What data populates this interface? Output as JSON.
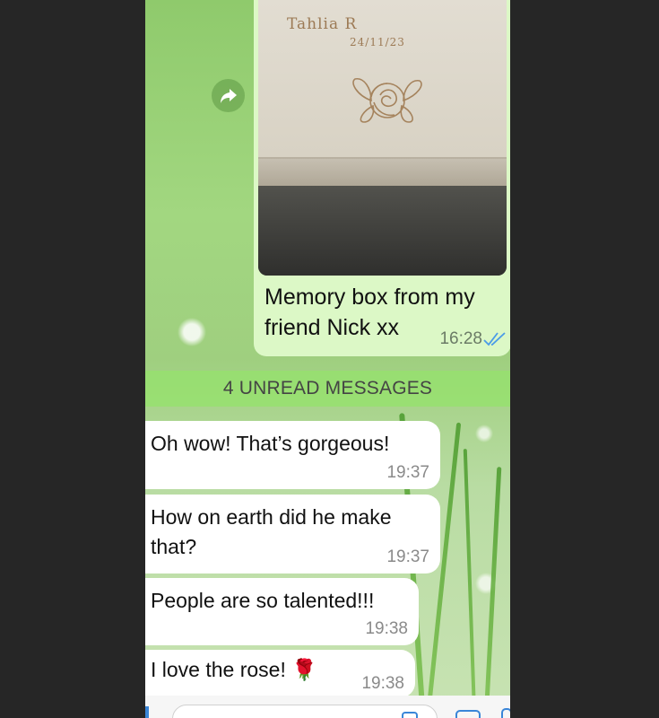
{
  "photo": {
    "engraved_name": "Tahlia R",
    "engraved_date": "24/11/23"
  },
  "outgoing": {
    "caption": "Memory box from my friend Nick xx",
    "time": "16:28",
    "status_icon": "double-check-read-icon"
  },
  "unread_banner": "4 UNREAD MESSAGES",
  "incoming": [
    {
      "text": "Oh wow! That’s gorgeous!",
      "time": "19:37"
    },
    {
      "text": "How on earth did he make that?",
      "time": "19:37"
    },
    {
      "text": "People are so talented!!!",
      "time": "19:38"
    },
    {
      "text": "I love the rose! 🌹",
      "time": "19:38"
    }
  ],
  "colors": {
    "outgoing_bubble": "#dcf8c6",
    "incoming_bubble": "#ffffff",
    "unread_banner": "#96e16e",
    "read_ticks": "#4a9be8"
  }
}
